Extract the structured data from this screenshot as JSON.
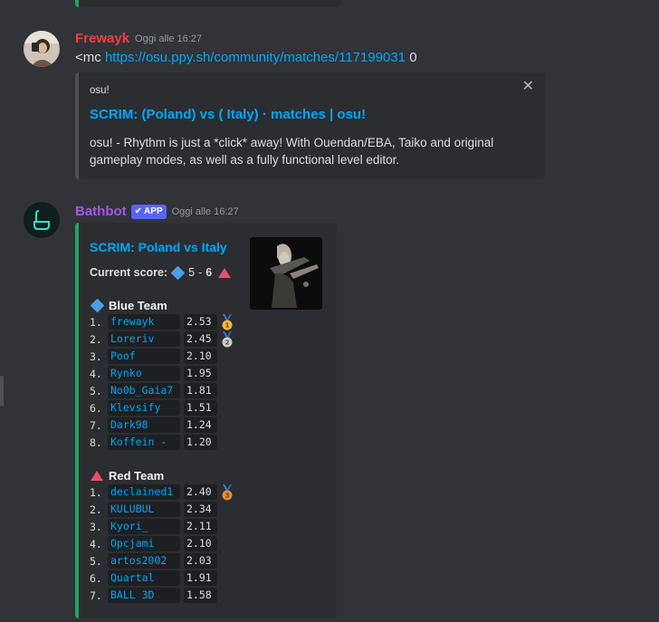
{
  "messages": [
    {
      "author": "Frewayk",
      "author_color": "#f23f43",
      "timestamp": "Oggi alle 16:27",
      "content_prefix": "<mc ",
      "content_link": "https://osu.ppy.sh/community/matches/117199031",
      "content_suffix": " 0",
      "embed": {
        "provider": "osu!",
        "title": "SCRIM: (Poland) vs ( Italy) · matches | osu!",
        "description": "osu! - Rhythm is just a *click* away! With Ouendan/EBA, Taiko and original gameplay modes, as well as a fully functional level editor."
      }
    },
    {
      "author": "Bathbot",
      "author_color": "#a358e3",
      "badge": "APP",
      "timestamp": "Oggi alle 16:27",
      "embed": {
        "title": "SCRIM: Poland vs  Italy",
        "score_label": "Current score",
        "score_blue": "5",
        "score_sep": "-",
        "score_red": "6",
        "blue_team": {
          "name": "Blue Team",
          "players": [
            {
              "idx": "1.",
              "name": "frewayk",
              "score": "2.53",
              "medal": "1"
            },
            {
              "idx": "2.",
              "name": "Loreriv",
              "score": "2.45",
              "medal": "2"
            },
            {
              "idx": "3.",
              "name": "Poof",
              "score": "2.10",
              "medal": ""
            },
            {
              "idx": "4.",
              "name": "Rynko",
              "score": "1.95",
              "medal": ""
            },
            {
              "idx": "5.",
              "name": "No0b_Gaia7",
              "score": "1.81",
              "medal": ""
            },
            {
              "idx": "6.",
              "name": "Klevsify",
              "score": "1.51",
              "medal": ""
            },
            {
              "idx": "7.",
              "name": "Dark98",
              "score": "1.24",
              "medal": ""
            },
            {
              "idx": "8.",
              "name": "Koffein -",
              "score": "1.20",
              "medal": ""
            }
          ]
        },
        "red_team": {
          "name": "Red Team",
          "players": [
            {
              "idx": "1.",
              "name": "declained1",
              "score": "2.40",
              "medal": "3"
            },
            {
              "idx": "2.",
              "name": "KULUBUL",
              "score": "2.34",
              "medal": ""
            },
            {
              "idx": "3.",
              "name": "Kyori_",
              "score": "2.11",
              "medal": ""
            },
            {
              "idx": "4.",
              "name": "Opcjami",
              "score": "2.10",
              "medal": ""
            },
            {
              "idx": "5.",
              "name": "artos2002",
              "score": "2.03",
              "medal": ""
            },
            {
              "idx": "6.",
              "name": "Quartal",
              "score": "1.91",
              "medal": ""
            },
            {
              "idx": "7.",
              "name": "BALL 3D",
              "score": "1.58",
              "medal": ""
            }
          ]
        }
      }
    }
  ],
  "colors": {
    "background": "#313338",
    "embed_bg": "#2b2d31",
    "link": "#00a8fc",
    "embed_accent": "#23a559",
    "blue_diamond": "#4e9de8",
    "red_triangle": "#e8506a",
    "app_badge": "#5865f2"
  },
  "icons": [
    "close-icon",
    "blue-diamond-icon",
    "red-triangle-icon",
    "gold-medal-icon",
    "silver-medal-icon",
    "bronze-medal-icon",
    "verified-check-icon"
  ]
}
